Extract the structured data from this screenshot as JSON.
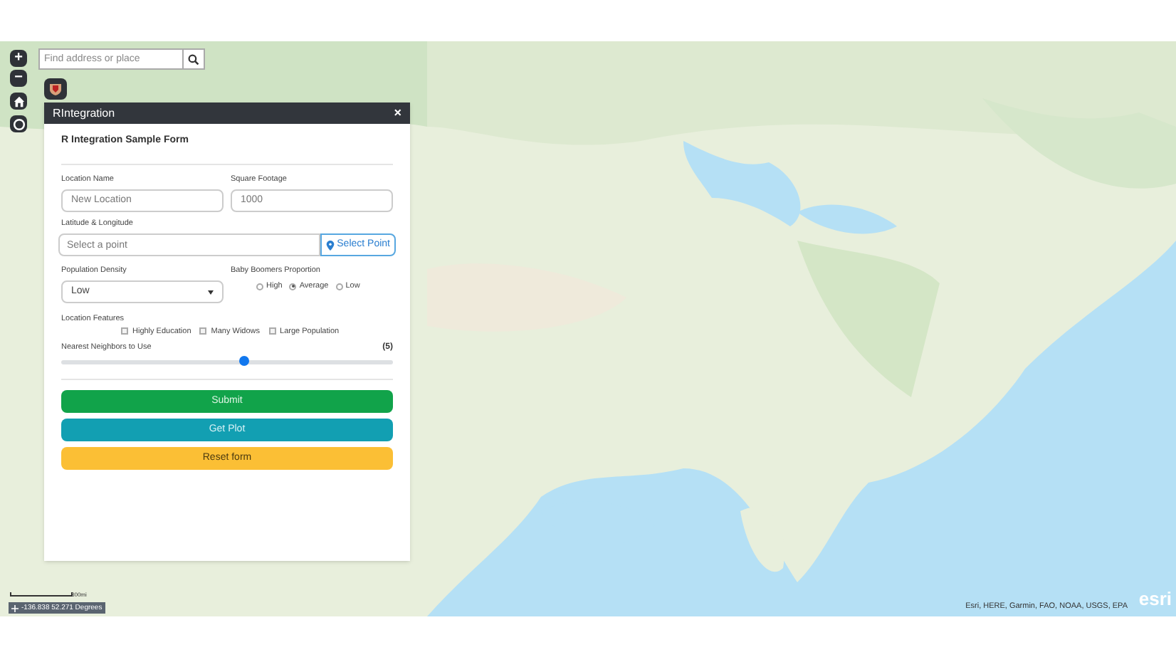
{
  "zoom_controls": [
    {
      "label": "+"
    },
    {
      "label": "−"
    }
  ],
  "search": {
    "placeholder": "Find address or place"
  },
  "panel": {
    "title": "RIntegration",
    "close": "×",
    "form_title": "R Integration Sample Form",
    "fields": [
      {
        "label": "Location Name",
        "placeholder": "New Location"
      },
      {
        "label": "Square Footage",
        "placeholder": "1000"
      }
    ],
    "latlong": {
      "label": "Latitude & Longitude",
      "placeholder": "Select a point",
      "button": "Select Point"
    },
    "density": {
      "label": "Population Density",
      "value": "Low"
    },
    "boomers": {
      "label": "Baby Boomers Proportion",
      "options": [
        {
          "label": "High",
          "selected": false
        },
        {
          "label": "Average",
          "selected": true
        },
        {
          "label": "Low",
          "selected": false
        }
      ]
    },
    "features": {
      "label": "Location Features",
      "options": [
        {
          "label": "Highly Education",
          "checked": false
        },
        {
          "label": "Many Widows",
          "checked": false
        },
        {
          "label": "Large Population",
          "checked": false
        }
      ]
    },
    "neighbors": {
      "label": "Nearest Neighbors to Use",
      "reading": "(5)",
      "level": 0.55
    },
    "buttons": [
      {
        "label": "Submit",
        "kind": "submit"
      },
      {
        "label": "Get Plot",
        "kind": "plot"
      },
      {
        "label": "Reset form",
        "kind": "reset"
      }
    ]
  },
  "scale": {
    "label": "300mi"
  },
  "coordinates": "-136.838 52.271 Degrees",
  "attribution": "Esri, HERE, Garmin, FAO, NOAA, USGS, EPA",
  "logo": "esri"
}
